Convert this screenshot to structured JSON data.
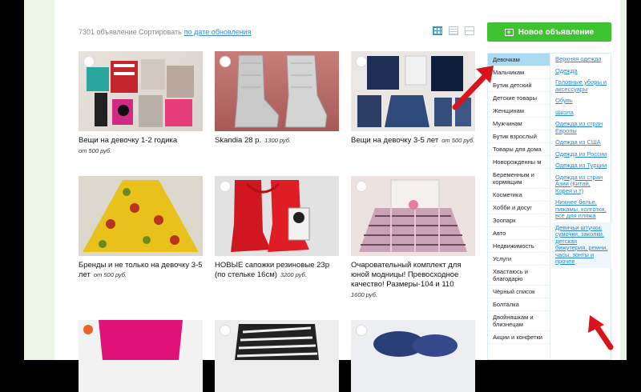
{
  "header": {
    "count": "7301 объявление",
    "sort_label": "Сортировать",
    "sort_value": "по дате обновления",
    "new_ad_button": "Новое объявление"
  },
  "cards": [
    {
      "title": "Вещи на девочку 1-2 годика",
      "price": "от 500 руб."
    },
    {
      "title": "Skandia 28 р.",
      "price": "1300 руб."
    },
    {
      "title": "Вещи на девочку 3-5 лет",
      "price": "от 500 руб."
    },
    {
      "title": "Бренды и не только на девочку 3-5 лет",
      "price": "от 500 руб."
    },
    {
      "title": "НОВЫЕ сапожки резиновые 23р (по стельке 16см)",
      "price": "3200 руб."
    },
    {
      "title": "Очаровательный комплект для юной модницы! Превосходное качество! Размеры-104 и 110",
      "price": "1600 руб."
    }
  ],
  "categories_left": [
    "Девочкам",
    "Мальчикам",
    "Бутик детский",
    "Детские товары",
    "Женщинам",
    "Мужчинам",
    "Бутик взрослый",
    "Товары для дома",
    "Новорожденны м",
    "Беременным и кормящим",
    "Косметика",
    "Хобби и досуг",
    "Зоопарк",
    "Авто",
    "Недвижимость",
    "Услуги",
    "Хвастаюсь и благодарю",
    "Чёрный список",
    "Болталка",
    "Двойняшкам и близнецам",
    "Акции и конфетки"
  ],
  "categories_right": [
    "Верхняя одежда",
    "Одежда",
    "Головные уборы и аксессуары",
    "Обувь",
    "Школа",
    "Одежда из стран Европы",
    "Одежда из США",
    "Одежда из России",
    "Одежда из Турции",
    "Одежда из стран Азии (Китай, Корея и т)",
    "Нижнее белье, пижамы, колготки, все для пляжа",
    "Девичьи штучки: сумочки, заколки, детская бижутерия, ремни, часы, зонты и прочее"
  ],
  "colors": {
    "accent_green": "#3cc32f",
    "link_blue": "#2a8ad0",
    "active_cat": "#a9dcf2",
    "arrow_red": "#d8141c"
  }
}
